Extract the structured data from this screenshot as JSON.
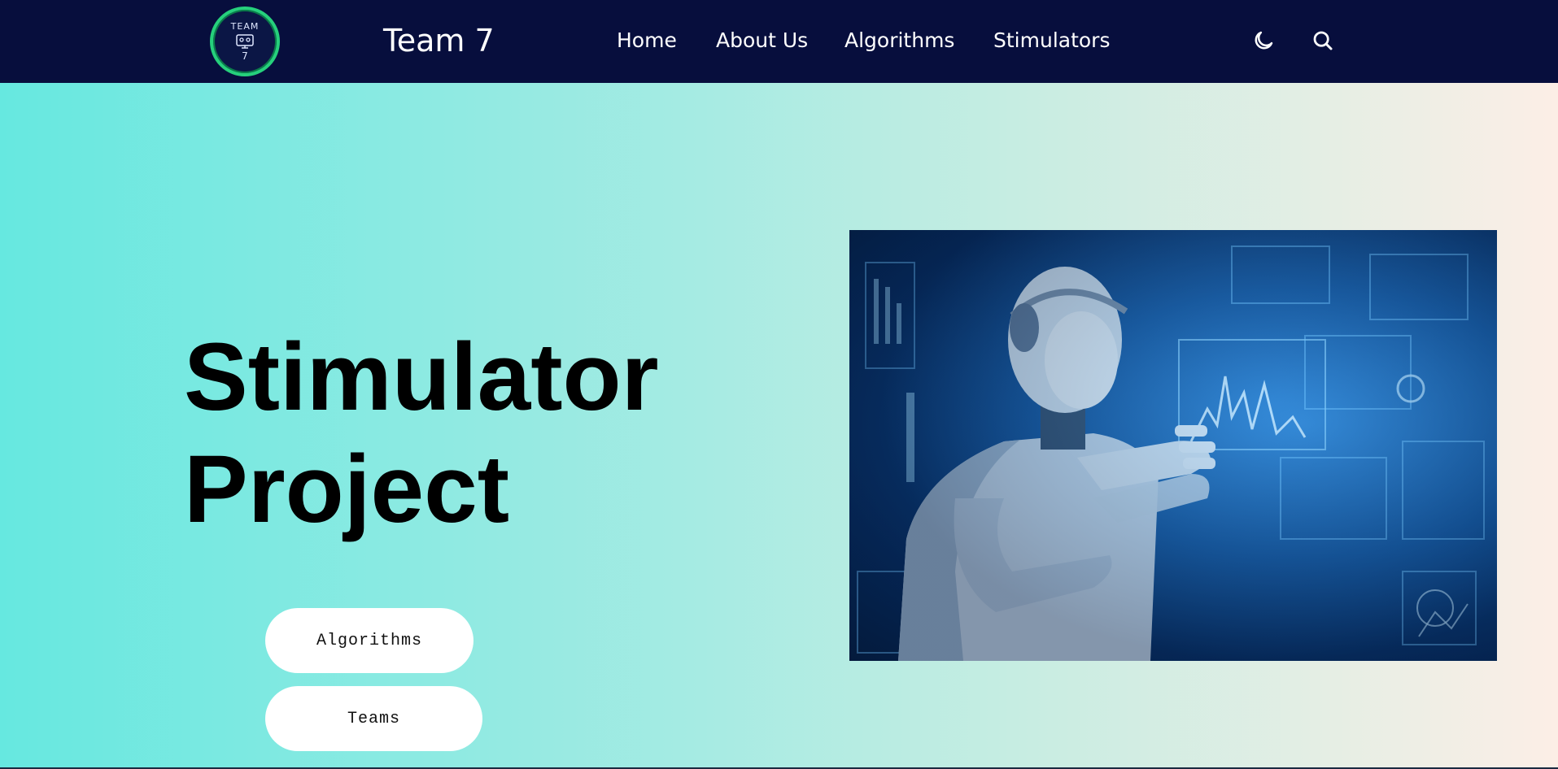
{
  "navbar": {
    "logo": {
      "top_text": "TEAM",
      "bottom_text": "7"
    },
    "brand": "Team 7",
    "links": [
      {
        "label": "Home"
      },
      {
        "label": "About Us"
      },
      {
        "label": "Algorithms"
      },
      {
        "label": "Stimulators"
      }
    ],
    "icons": [
      "moon-icon",
      "search-icon"
    ]
  },
  "hero": {
    "title_line1": "Stimulator",
    "title_line2": "Project",
    "buttons": [
      {
        "label": "Algorithms"
      },
      {
        "label": "Teams"
      }
    ],
    "image": {
      "subject": "humanoid-robot-with-holographic-displays"
    }
  },
  "colors": {
    "nav_bg": "#070e3d",
    "logo_ring": "#26d07c",
    "gradient_start": "#66e8e0",
    "gradient_end": "#fceee6",
    "button_bg": "#ffffff"
  }
}
